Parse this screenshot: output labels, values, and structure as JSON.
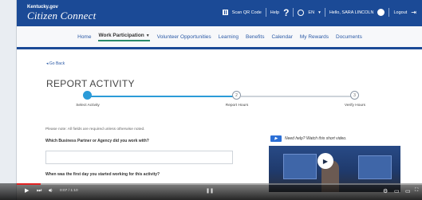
{
  "header": {
    "brand_small": "Kentucky.gov",
    "brand_main": "Citizen Connect",
    "qr_label": "Scan QR Code",
    "help_label": "Help",
    "help_symbol": "?",
    "lang_label": "EN",
    "user_label": "Hello, SARA LINCOLN",
    "logout_label": "Logout",
    "brand_color": "#1b4a96"
  },
  "nav": {
    "items": [
      "Home",
      "Work Participation",
      "Volunteer Opportunities",
      "Learning",
      "Benefits",
      "Calendar",
      "My Rewards",
      "Documents"
    ],
    "active": "Work Participation"
  },
  "page": {
    "go_back": "◂ Go Back",
    "title": "REPORT ACTIVITY",
    "steps": [
      {
        "number": "1",
        "label": "Select Activity",
        "state": "active"
      },
      {
        "number": "2",
        "label": "Report Hours",
        "state": "pending"
      },
      {
        "number": "3",
        "label": "Verify Hours",
        "state": "pending"
      }
    ],
    "note": "Please note: All fields are required unless otherwise noted.",
    "question1": "Which Business Partner or Agency did you work with?",
    "question1_value": "",
    "question2": "When was the first day you started working for this activity?",
    "help_video_label": "Need help? Watch this short video."
  },
  "player": {
    "time": "0:07 / 1:10",
    "progress": 0.06,
    "accent": "#e22222"
  }
}
